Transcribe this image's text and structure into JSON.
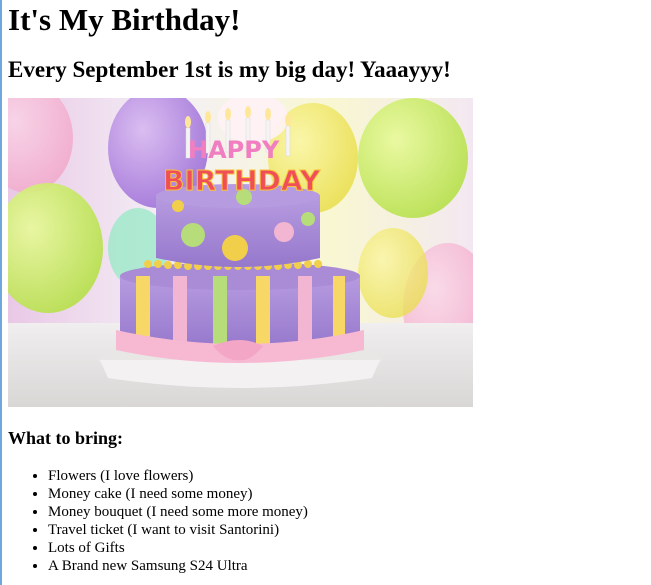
{
  "page": {
    "title": "It's My Birthday!",
    "subtitle": "Every September 1st is my big day! Yaaayyy!",
    "image": {
      "topper_line1": "HAPPY",
      "topper_line2": "BIRTHDAY"
    },
    "list_heading": "What to bring:",
    "items": [
      "Flowers (I love flowers)",
      "Money cake (I need some money)",
      "Money bouquet (I need some more money)",
      "Travel ticket (I want to visit Santorini)",
      "Lots of Gifts",
      "A Brand new Samsung S24 Ultra"
    ]
  },
  "colors": {
    "accent_border": "#6fa8dc",
    "cake_top": "#a98bd6",
    "cake_bottom": "#9a78d0",
    "ribbon": "#f7b8d2"
  }
}
